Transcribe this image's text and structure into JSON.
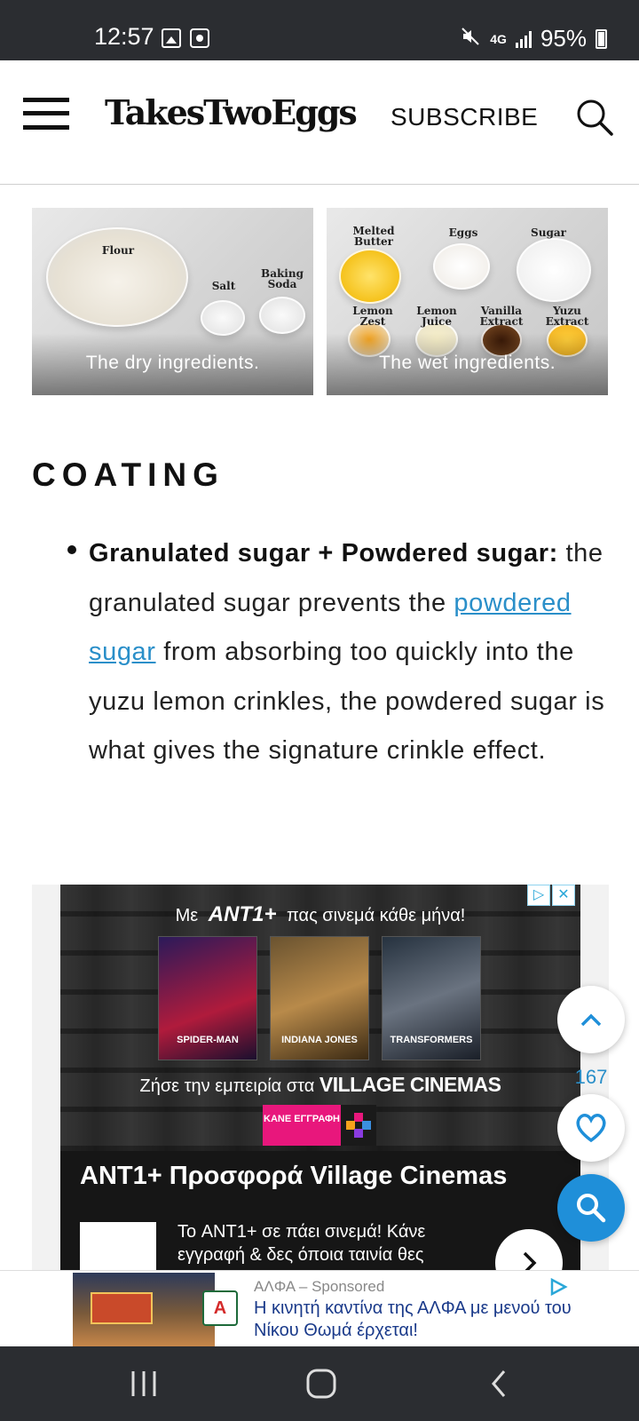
{
  "status_bar": {
    "time": "12:57",
    "network": "4G",
    "battery": "95%"
  },
  "header": {
    "logo": "TakesTwoEggs",
    "subscribe_label": "SUBSCRIBE"
  },
  "images": [
    {
      "caption": "The dry ingredients.",
      "labels": [
        "Flour",
        "Salt",
        "Baking Soda"
      ]
    },
    {
      "caption": "The wet ingredients.",
      "labels": [
        "Melted Butter",
        "Eggs",
        "Sugar",
        "Lemon Zest",
        "Lemon Juice",
        "Vanilla Extract",
        "Yuzu Extract"
      ]
    }
  ],
  "article": {
    "section_title": "COATING",
    "bullet_bold": "Granulated sugar + Powdered sugar:",
    "bullet_text_1": " the granulated sugar prevents the ",
    "link_text": "powdered sugar",
    "bullet_text_2": " from absorbing too quickly into the yuzu lemon crinkles, the powdered sugar is what gives the signature crinkle effect."
  },
  "ad": {
    "top_prefix": "Με",
    "top_brand": "ANT1+",
    "top_suffix": "πας σινεμά κάθε μήνα!",
    "posters": [
      "SPIDER-MAN",
      "INDIANA JONES",
      "TRANSFORMERS"
    ],
    "mid_text": "Ζήσε την εμπειρία στα",
    "mid_brand": "VILLAGE CINEMAS",
    "cta_label": "ΚΑΝΕ ΕΓΓΡΑΦΗ",
    "title": "ANT1+ Προσφορά Village Cinemas",
    "description": "Το ANT1+ σε πάει σινεμά! Κάνε εγγραφή & δες όποια ταινία θες"
  },
  "floating": {
    "favorite_count": "167"
  },
  "sponsored": {
    "advertiser": "ΑΛΦΑ",
    "separator": " – ",
    "sponsored_label": "Sponsored",
    "headline": "Η κινητή καντίνα της ΑΛΦΑ με μενού του Νίκου Θωμά έρχεται!",
    "logo_letter": "A"
  },
  "colors": {
    "link": "#2a8fc9",
    "fab_search": "#1f8fd9",
    "status_bar": "#2b2d31"
  }
}
